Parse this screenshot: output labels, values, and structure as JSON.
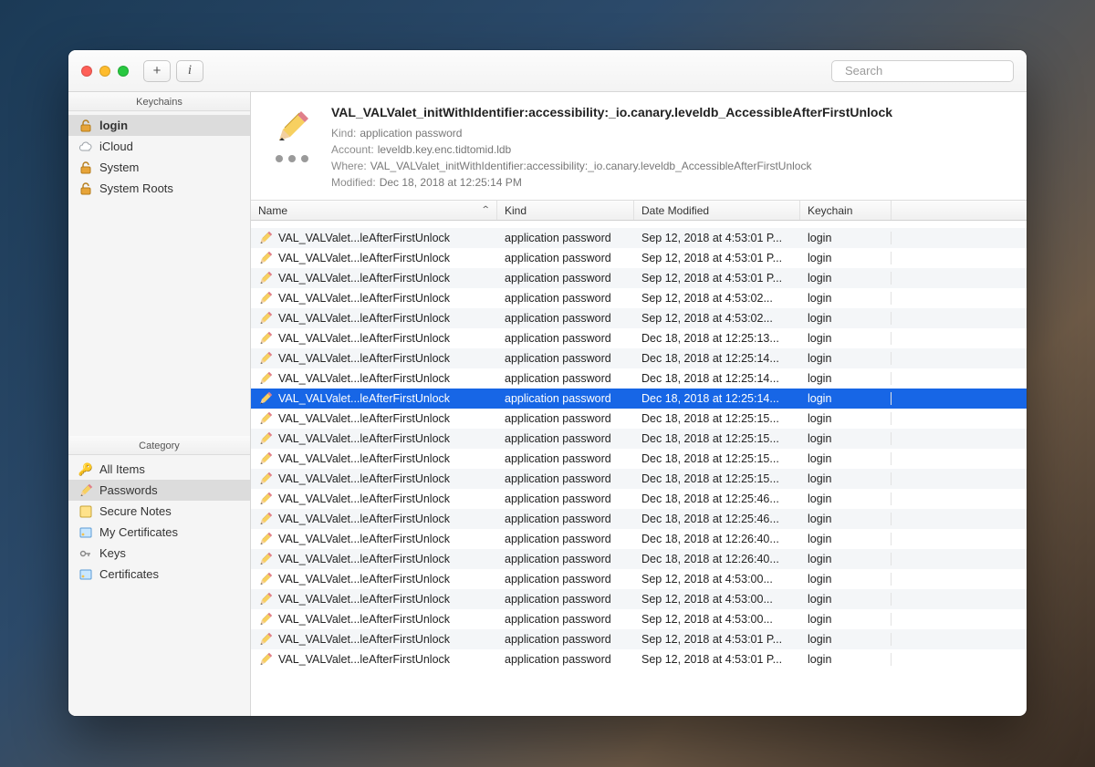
{
  "toolbar": {
    "search_placeholder": "Search",
    "add_label": "+",
    "info_label": "i"
  },
  "sidebar": {
    "keychains_header": "Keychains",
    "keychains": [
      {
        "label": "login",
        "icon": "lock-open",
        "selected": true
      },
      {
        "label": "iCloud",
        "icon": "cloud",
        "selected": false
      },
      {
        "label": "System",
        "icon": "lock-open",
        "selected": false
      },
      {
        "label": "System Roots",
        "icon": "lock-open",
        "selected": false
      }
    ],
    "category_header": "Category",
    "categories": [
      {
        "label": "All Items",
        "icon": "keys"
      },
      {
        "label": "Passwords",
        "icon": "pencil",
        "selected": true
      },
      {
        "label": "Secure Notes",
        "icon": "note"
      },
      {
        "label": "My Certificates",
        "icon": "cert"
      },
      {
        "label": "Keys",
        "icon": "key"
      },
      {
        "label": "Certificates",
        "icon": "cert"
      }
    ]
  },
  "detail": {
    "title": "VAL_VALValet_initWithIdentifier:accessibility:_io.canary.leveldb_AccessibleAfterFirstUnlock",
    "kind_label": "Kind:",
    "kind_value": "application password",
    "account_label": "Account:",
    "account_value": "leveldb.key.enc.tidtomid.ldb",
    "where_label": "Where:",
    "where_value": "VAL_VALValet_initWithIdentifier:accessibility:_io.canary.leveldb_AccessibleAfterFirstUnlock",
    "modified_label": "Modified:",
    "modified_value": "Dec 18, 2018 at 12:25:14 PM"
  },
  "table": {
    "headers": {
      "name": "Name",
      "kind": "Kind",
      "date": "Date Modified",
      "keychain": "Keychain"
    },
    "rows": [
      {
        "name": "VAL_VALValet...leAfterFirstUnlock",
        "kind": "application password",
        "date": "Sep 12, 2018 at 4:53:01 P...",
        "keychain": "login"
      },
      {
        "name": "VAL_VALValet...leAfterFirstUnlock",
        "kind": "application password",
        "date": "Sep 12, 2018 at 4:53:01 P...",
        "keychain": "login"
      },
      {
        "name": "VAL_VALValet...leAfterFirstUnlock",
        "kind": "application password",
        "date": "Sep 12, 2018 at 4:53:01 P...",
        "keychain": "login"
      },
      {
        "name": "VAL_VALValet...leAfterFirstUnlock",
        "kind": "application password",
        "date": "Sep 12, 2018 at 4:53:02...",
        "keychain": "login"
      },
      {
        "name": "VAL_VALValet...leAfterFirstUnlock",
        "kind": "application password",
        "date": "Sep 12, 2018 at 4:53:02...",
        "keychain": "login"
      },
      {
        "name": "VAL_VALValet...leAfterFirstUnlock",
        "kind": "application password",
        "date": "Dec 18, 2018 at 12:25:13...",
        "keychain": "login"
      },
      {
        "name": "VAL_VALValet...leAfterFirstUnlock",
        "kind": "application password",
        "date": "Dec 18, 2018 at 12:25:14...",
        "keychain": "login"
      },
      {
        "name": "VAL_VALValet...leAfterFirstUnlock",
        "kind": "application password",
        "date": "Dec 18, 2018 at 12:25:14...",
        "keychain": "login"
      },
      {
        "name": "VAL_VALValet...leAfterFirstUnlock",
        "kind": "application password",
        "date": "Dec 18, 2018 at 12:25:14...",
        "keychain": "login",
        "selected": true
      },
      {
        "name": "VAL_VALValet...leAfterFirstUnlock",
        "kind": "application password",
        "date": "Dec 18, 2018 at 12:25:15...",
        "keychain": "login"
      },
      {
        "name": "VAL_VALValet...leAfterFirstUnlock",
        "kind": "application password",
        "date": "Dec 18, 2018 at 12:25:15...",
        "keychain": "login"
      },
      {
        "name": "VAL_VALValet...leAfterFirstUnlock",
        "kind": "application password",
        "date": "Dec 18, 2018 at 12:25:15...",
        "keychain": "login"
      },
      {
        "name": "VAL_VALValet...leAfterFirstUnlock",
        "kind": "application password",
        "date": "Dec 18, 2018 at 12:25:15...",
        "keychain": "login"
      },
      {
        "name": "VAL_VALValet...leAfterFirstUnlock",
        "kind": "application password",
        "date": "Dec 18, 2018 at 12:25:46...",
        "keychain": "login"
      },
      {
        "name": "VAL_VALValet...leAfterFirstUnlock",
        "kind": "application password",
        "date": "Dec 18, 2018 at 12:25:46...",
        "keychain": "login"
      },
      {
        "name": "VAL_VALValet...leAfterFirstUnlock",
        "kind": "application password",
        "date": "Dec 18, 2018 at 12:26:40...",
        "keychain": "login"
      },
      {
        "name": "VAL_VALValet...leAfterFirstUnlock",
        "kind": "application password",
        "date": "Dec 18, 2018 at 12:26:40...",
        "keychain": "login"
      },
      {
        "name": "VAL_VALValet...leAfterFirstUnlock",
        "kind": "application password",
        "date": "Sep 12, 2018 at 4:53:00...",
        "keychain": "login"
      },
      {
        "name": "VAL_VALValet...leAfterFirstUnlock",
        "kind": "application password",
        "date": "Sep 12, 2018 at 4:53:00...",
        "keychain": "login"
      },
      {
        "name": "VAL_VALValet...leAfterFirstUnlock",
        "kind": "application password",
        "date": "Sep 12, 2018 at 4:53:00...",
        "keychain": "login"
      },
      {
        "name": "VAL_VALValet...leAfterFirstUnlock",
        "kind": "application password",
        "date": "Sep 12, 2018 at 4:53:01 P...",
        "keychain": "login"
      },
      {
        "name": "VAL_VALValet...leAfterFirstUnlock",
        "kind": "application password",
        "date": "Sep 12, 2018 at 4:53:01 P...",
        "keychain": "login"
      }
    ]
  },
  "icons": {
    "lock_open": "🔓",
    "cloud": "☁️",
    "keys": "🗝",
    "note": "📔",
    "cert": "📄",
    "key": "🔑"
  }
}
